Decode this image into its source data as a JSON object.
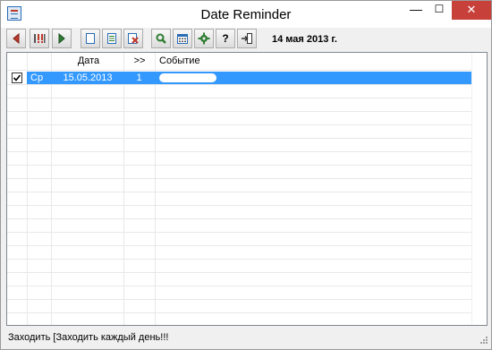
{
  "window": {
    "title": "Date Reminder",
    "minimize_glyph": "—",
    "maximize_glyph": "☐",
    "close_glyph": "✕"
  },
  "toolbar": {
    "buttons": [
      {
        "icon": "arrow-left-icon",
        "color": "#c0392b"
      },
      {
        "icon": "important-dates-icon",
        "color": "#c0392b"
      },
      {
        "icon": "arrow-right-icon",
        "color": "#2e7d32"
      },
      {
        "icon": "new-document-icon"
      },
      {
        "icon": "edit-document-icon"
      },
      {
        "icon": "delete-document-icon",
        "color": "#c0392b"
      },
      {
        "icon": "search-icon",
        "color": "#2e7d32"
      },
      {
        "icon": "calendar-icon"
      },
      {
        "icon": "gear-icon",
        "color": "#2e7d32"
      },
      {
        "icon": "help-icon"
      },
      {
        "icon": "exit-icon"
      }
    ],
    "help_glyph": "?",
    "current_date": "14 мая 2013 г."
  },
  "grid": {
    "columns": [
      "Дата",
      ">>",
      "Событие"
    ],
    "rows": [
      {
        "checked": true,
        "day": "Ср",
        "date": "15.05.2013",
        "count": "1",
        "event": ""
      }
    ]
  },
  "status": {
    "text": "Заходить [Заходить каждый день!!!"
  },
  "colors": {
    "selection": "#3399ff",
    "close_button": "#c7413a"
  }
}
